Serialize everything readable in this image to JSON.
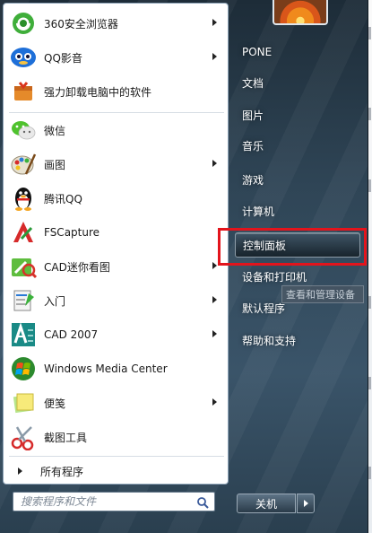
{
  "left_panel": {
    "programs": [
      {
        "label": "360安全浏览器",
        "icon": "360-browser-icon",
        "has_submenu": true
      },
      {
        "label": "QQ影音",
        "icon": "qq-player-icon",
        "has_submenu": true
      },
      {
        "label": "强力卸载电脑中的软件",
        "icon": "uninstaller-icon",
        "has_submenu": false
      },
      {
        "label": "微信",
        "icon": "wechat-icon",
        "has_submenu": false
      },
      {
        "label": "画图",
        "icon": "paint-icon",
        "has_submenu": true
      },
      {
        "label": "腾讯QQ",
        "icon": "qq-penguin-icon",
        "has_submenu": false
      },
      {
        "label": "FSCapture",
        "icon": "fscapture-icon",
        "has_submenu": false
      },
      {
        "label": "CAD迷你看图",
        "icon": "cad-mini-viewer-icon",
        "has_submenu": true
      },
      {
        "label": "入门",
        "icon": "getting-started-icon",
        "has_submenu": true
      },
      {
        "label": "CAD 2007",
        "icon": "autocad-icon",
        "has_submenu": true
      },
      {
        "label": "Windows Media Center",
        "icon": "media-center-icon",
        "has_submenu": false
      },
      {
        "label": "便笺",
        "icon": "sticky-notes-icon",
        "has_submenu": true
      },
      {
        "label": "截图工具",
        "icon": "snipping-tool-icon",
        "has_submenu": false
      }
    ],
    "all_programs_label": "所有程序",
    "search_placeholder": "搜索程序和文件"
  },
  "right_panel": {
    "items": [
      {
        "label": "PONE",
        "highlighted": false
      },
      {
        "label": "文档",
        "highlighted": false
      },
      {
        "label": "图片",
        "highlighted": false
      },
      {
        "label": "音乐",
        "highlighted": false
      },
      {
        "label": "游戏",
        "highlighted": false
      },
      {
        "label": "计算机",
        "highlighted": false
      },
      {
        "label": "控制面板",
        "highlighted": true
      },
      {
        "label": "设备和打印机",
        "highlighted": false
      },
      {
        "label": "默认程序",
        "highlighted": false
      },
      {
        "label": "帮助和支持",
        "highlighted": false
      }
    ],
    "tooltip": "查看和管理设备",
    "shutdown_label": "关机"
  },
  "colors": {
    "highlight_box": "#e3141c",
    "menu_glass": "#2f4556"
  }
}
